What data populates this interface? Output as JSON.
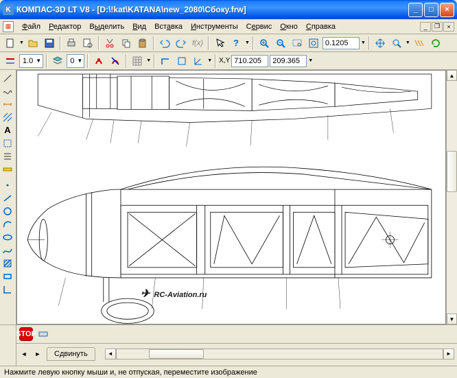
{
  "title": "КОМПАС-3D LT V8 - [D:\\!kat\\KATANA\\new_2080\\Cбоку.frw]",
  "menu": {
    "file": "Файл",
    "edit": "Редактор",
    "select": "Выделить",
    "view": "Вид",
    "insert": "Вставка",
    "tools": "Инструменты",
    "service": "Сервис",
    "window": "Окно",
    "help": "Справка"
  },
  "toolbar2": {
    "zoom_value": "0.1205",
    "line_width": "1.0",
    "layer": "0",
    "coord_x": "710.205",
    "coord_y": "209.365"
  },
  "bottom": {
    "tab_label": "Сдвинуть",
    "stop_label": "STOP"
  },
  "status": "Нажмите левую кнопку мыши и, не отпуская, переместите изображение",
  "watermark": "RC-Aviation.ru",
  "win_min": "_",
  "win_max": "□",
  "win_close": "×"
}
